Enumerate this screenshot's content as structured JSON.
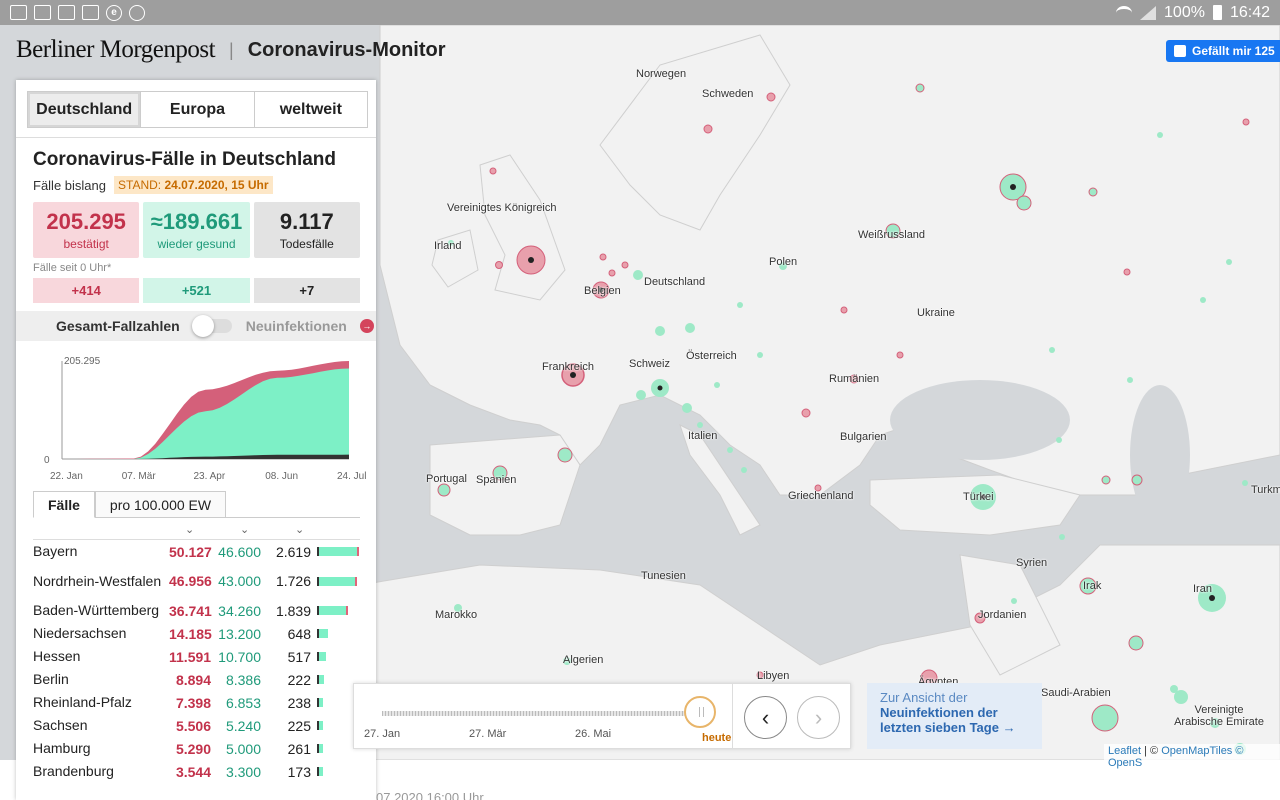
{
  "statusbar": {
    "battery": "100%",
    "time": "16:42"
  },
  "header": {
    "brand": "Berliner Morgenpost",
    "separator": "|",
    "title": "Coronavirus-Monitor",
    "fb_like": "Gefällt mir 125"
  },
  "region_tabs": [
    "Deutschland",
    "Europa",
    "weltweit"
  ],
  "summary": {
    "title": "Coronavirus-Fälle in Deutschland",
    "subtitle": "Fälle bislang",
    "stand_label": "STAND:",
    "stand_value": "24.07.2020, 15 Uhr",
    "confirmed": "205.295",
    "confirmed_label": "bestätigt",
    "recovered": "≈189.661",
    "recovered_label": "wieder gesund",
    "deaths": "9.117",
    "deaths_label": "Todesfälle",
    "today_label": "Fälle seit 0 Uhr*",
    "today_confirmed": "+414",
    "today_recovered": "+521",
    "today_deaths": "+7"
  },
  "toggle": {
    "left": "Gesamt-Fallzahlen",
    "right": "Neuinfektionen",
    "info": "→"
  },
  "chart_data": {
    "type": "area",
    "title": "",
    "x": [
      "22. Jan",
      "07. Mär",
      "23. Apr",
      "08. Jun",
      "24. Jul"
    ],
    "ylim": [
      0,
      205295
    ],
    "yticks": [
      "205.295",
      "0"
    ],
    "series": [
      {
        "values": [
          0,
          1000,
          145000,
          185000,
          205295
        ]
      },
      {
        "values": [
          0,
          50,
          100000,
          170000,
          189661
        ]
      },
      {
        "values": [
          0,
          0,
          5000,
          8700,
          9117
        ]
      }
    ],
    "colors": {
      "confirmed": "#d4607a",
      "recovered": "#7df0c6",
      "deaths": "#333333"
    }
  },
  "table": {
    "tabs": [
      "Fälle",
      "pro 100.000 EW"
    ],
    "sort_icons": [
      "chevron-down",
      "chevron-down",
      "chevron-down"
    ],
    "rows": [
      {
        "name": "Bayern",
        "cases": "50.127",
        "recovered": "46.600",
        "deaths": "2.619",
        "bar": 0.98
      },
      {
        "name": "Nordrhein-Westfalen",
        "cases": "46.956",
        "recovered": "43.000",
        "deaths": "1.726",
        "bar": 0.92
      },
      {
        "name": "Baden-Württemberg",
        "cases": "36.741",
        "recovered": "34.260",
        "deaths": "1.839",
        "bar": 0.72
      },
      {
        "name": "Niedersachsen",
        "cases": "14.185",
        "recovered": "13.200",
        "deaths": "648",
        "bar": 0.28
      },
      {
        "name": "Hessen",
        "cases": "11.591",
        "recovered": "10.700",
        "deaths": "517",
        "bar": 0.23
      },
      {
        "name": "Berlin",
        "cases": "8.894",
        "recovered": "8.386",
        "deaths": "222",
        "bar": 0.18
      },
      {
        "name": "Rheinland-Pfalz",
        "cases": "7.398",
        "recovered": "6.853",
        "deaths": "238",
        "bar": 0.15
      },
      {
        "name": "Sachsen",
        "cases": "5.506",
        "recovered": "5.240",
        "deaths": "225",
        "bar": 0.11
      },
      {
        "name": "Hamburg",
        "cases": "5.290",
        "recovered": "5.000",
        "deaths": "261",
        "bar": 0.105
      },
      {
        "name": "Brandenburg",
        "cases": "3.544",
        "recovered": "3.300",
        "deaths": "173",
        "bar": 0.07
      }
    ]
  },
  "timeline": {
    "labels": [
      "27. Jan",
      "27. Mär",
      "26. Mai",
      "heute"
    ],
    "prev": "‹",
    "next": "›"
  },
  "week_link": {
    "line1": "Zur Ansicht der",
    "line2": "Neuinfektionen der",
    "line3": "letzten sieben Tage →"
  },
  "attribution": {
    "leaflet": "Leaflet",
    "sep": "| ©",
    "tiles": "OpenMapTiles",
    "more": "© OpenS"
  },
  "footer": "07.2020 16:00 Uhr",
  "map": {
    "labels": [
      "Norwegen",
      "Schweden",
      "Vereinigtes Königreich",
      "Irland",
      "Weißrussland",
      "Polen",
      "Deutschland",
      "Belgien",
      "Ukraine",
      "Frankreich",
      "Schweiz",
      "Österreich",
      "Rumänien",
      "Italien",
      "Bulgarien",
      "Portugal",
      "Spanien",
      "Griechenland",
      "Türkei",
      "Turkmenistan",
      "Tunesien",
      "Syrien",
      "Irak",
      "Iran",
      "Marokko",
      "Jordanien",
      "Algerien",
      "Libyen",
      "Ägypten",
      "Saudi-Arabien",
      "Vereinigte Arabische Emirate"
    ]
  }
}
